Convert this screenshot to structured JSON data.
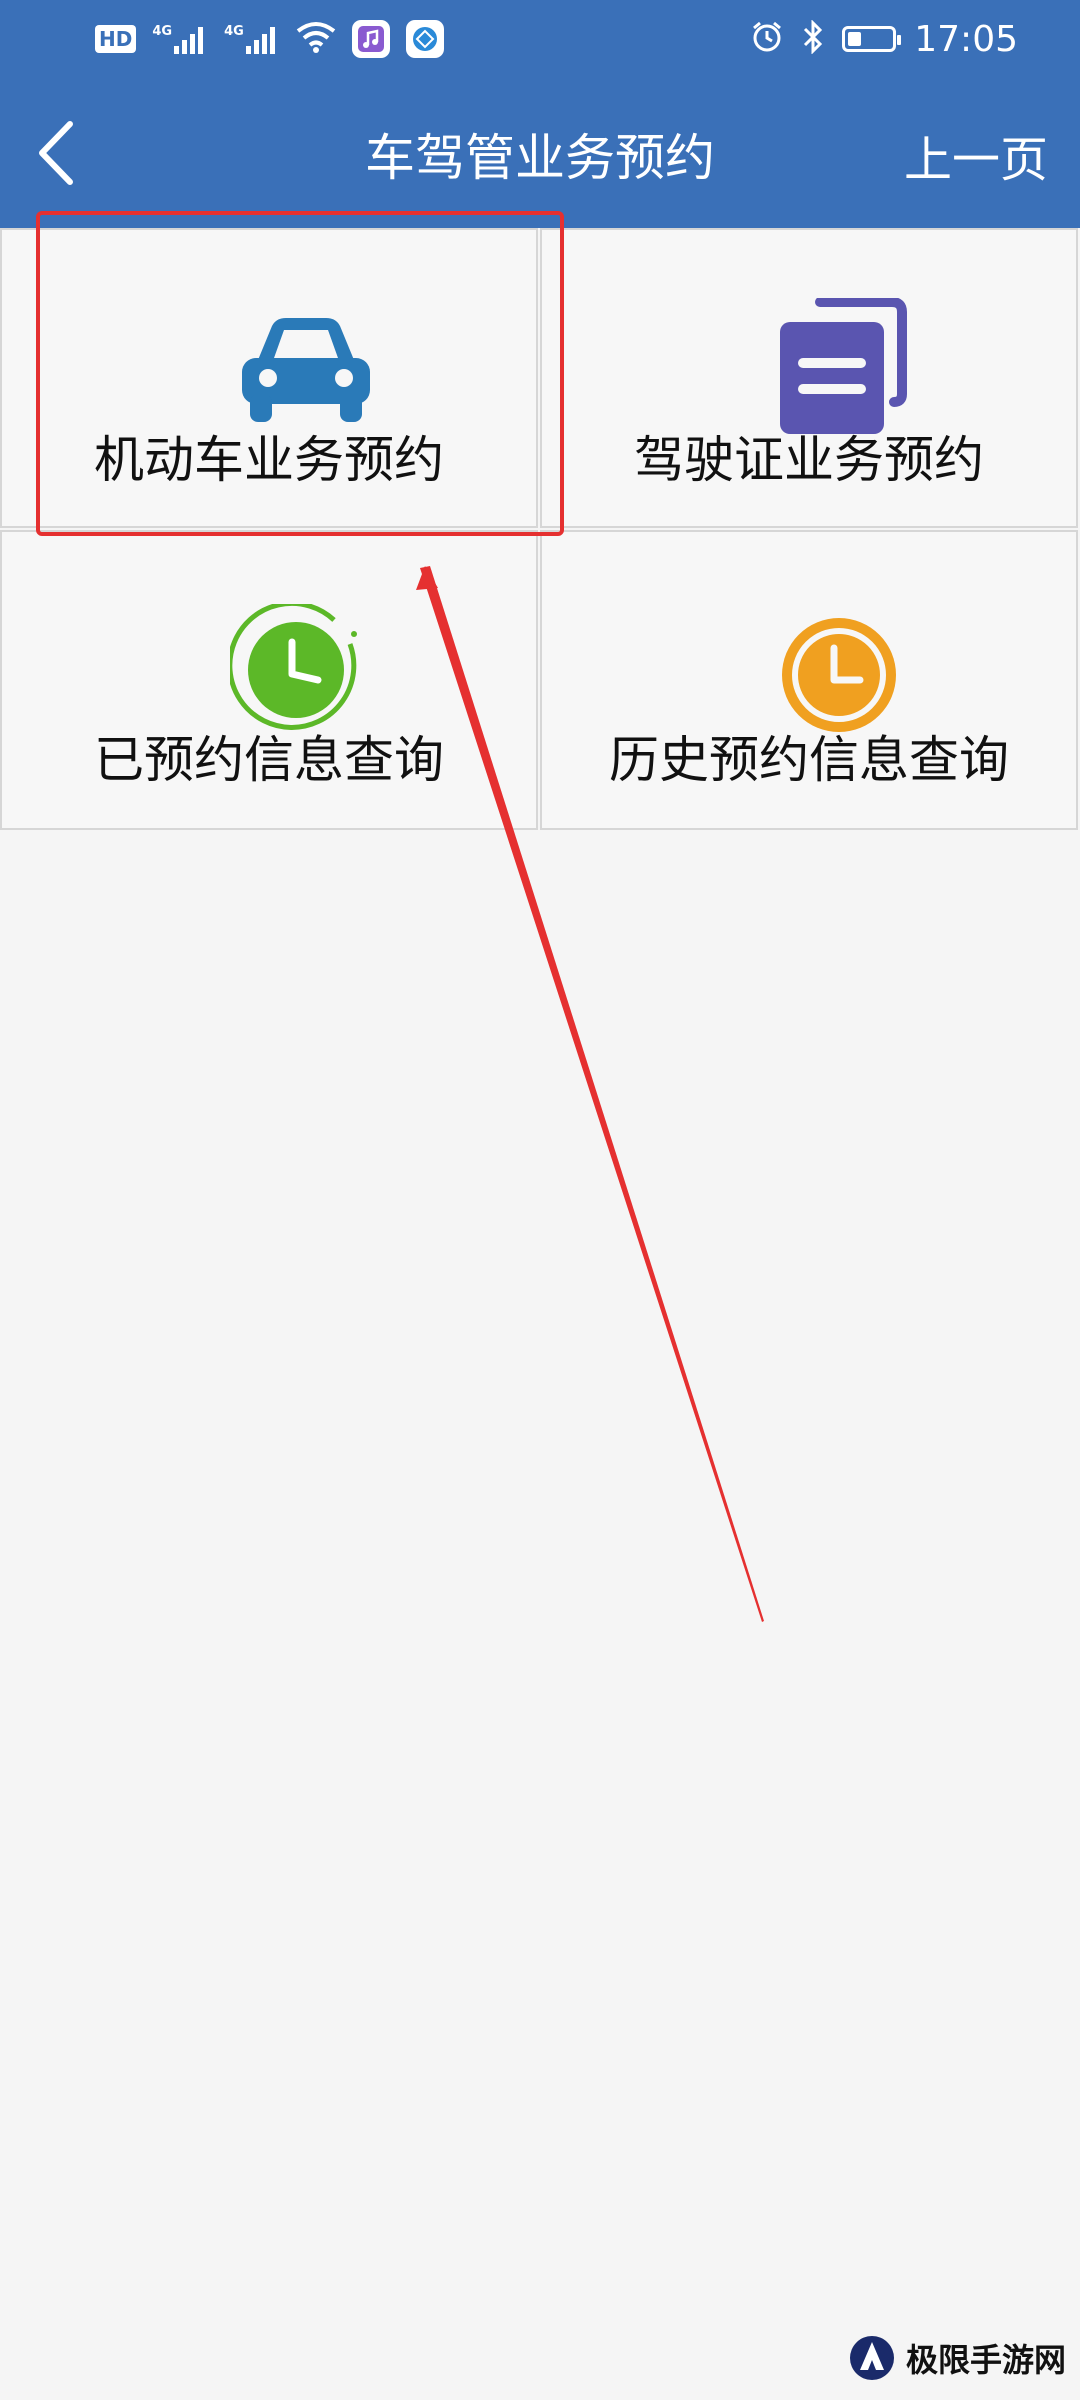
{
  "status_bar": {
    "hd_label": "HD",
    "sim1_label": "4G",
    "sim2_label": "4G",
    "time": "17:05",
    "battery_level": 0.3,
    "icons": [
      "hd-icon",
      "signal-icon",
      "signal-icon",
      "wifi-icon",
      "music-app-icon",
      "browser-app-icon",
      "alarm-icon",
      "bluetooth-icon",
      "battery-icon"
    ]
  },
  "nav": {
    "title": "车驾管业务预约",
    "right_label": "上一页"
  },
  "menu": {
    "items": [
      {
        "label": "机动车业务预约",
        "icon": "car-icon",
        "color": "#2a7ab8"
      },
      {
        "label": "驾驶证业务预约",
        "icon": "document-icon",
        "color": "#5a55b0"
      },
      {
        "label": "已预约信息查询",
        "icon": "clock-icon",
        "color": "#5cb828"
      },
      {
        "label": "历史预约信息查询",
        "icon": "clock-icon",
        "color": "#f0a020"
      }
    ]
  },
  "annotation": {
    "highlight_color": "#e53030",
    "arrow_color": "#e53030"
  },
  "watermark": {
    "text": "极限手游网"
  },
  "theme": {
    "header_bg": "#3a70b8",
    "page_bg": "#f5f5f5"
  }
}
